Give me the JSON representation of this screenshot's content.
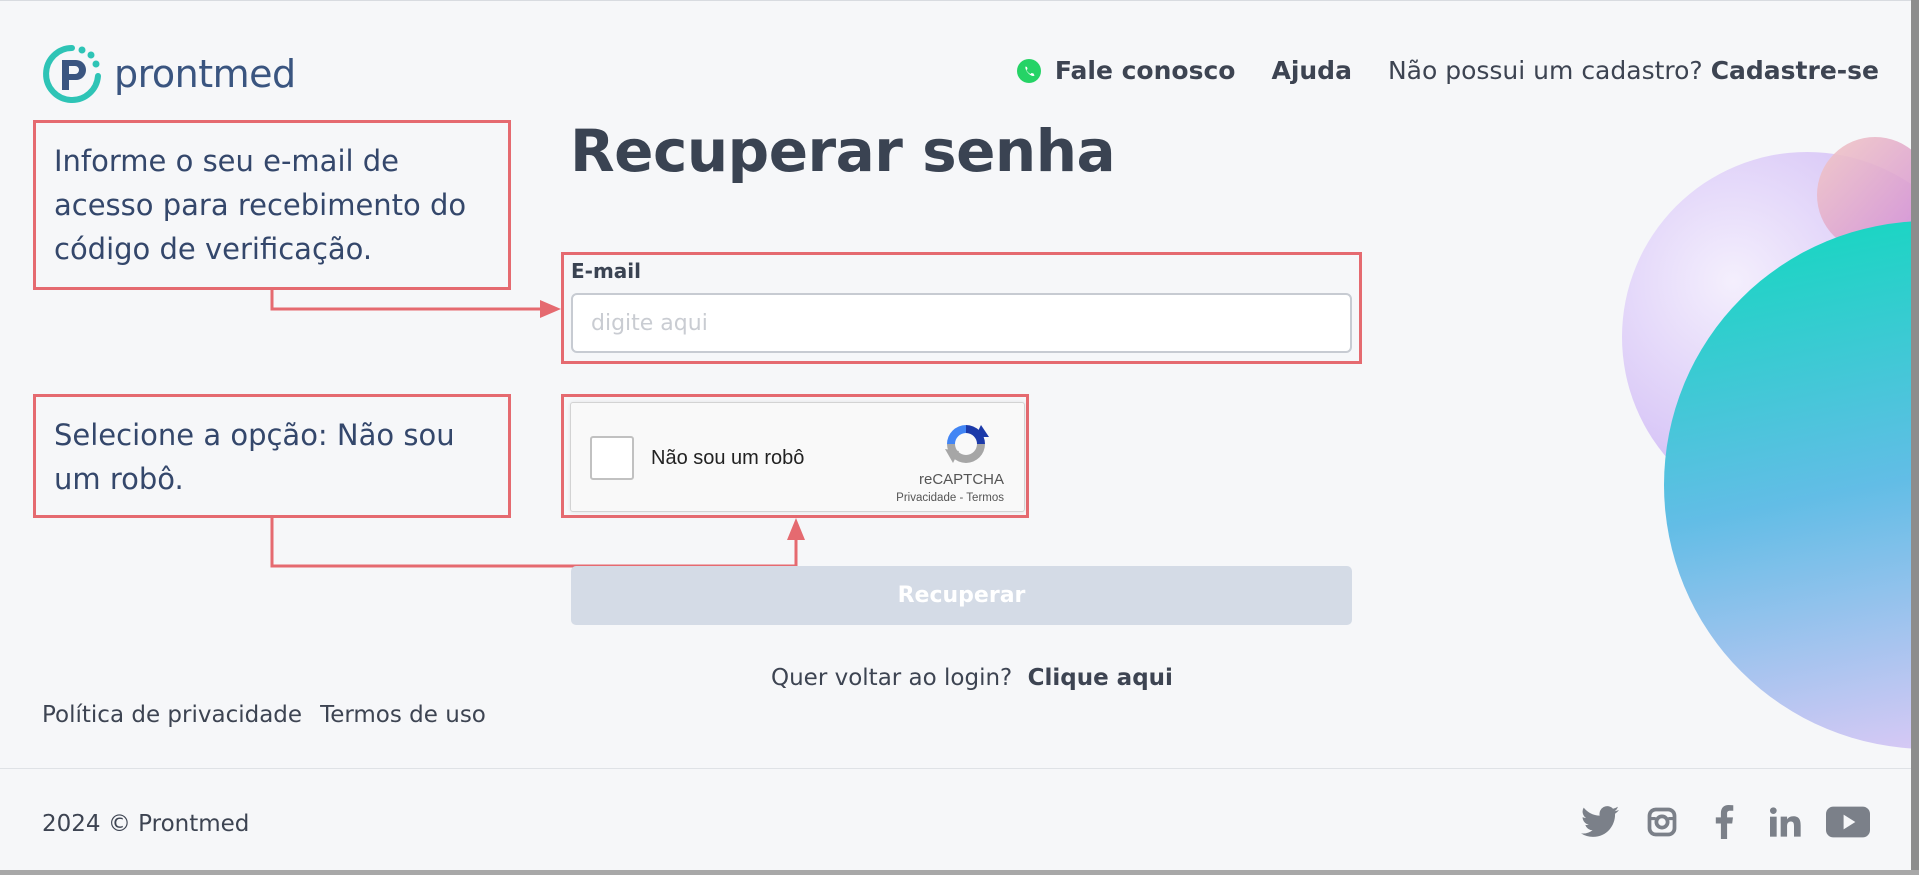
{
  "brand": {
    "name": "prontmed",
    "accent": "#2ec4b6",
    "dark": "#3a5580"
  },
  "nav": {
    "contact": "Fale conosco",
    "help": "Ajuda",
    "signup_question": "Não possui um cadastro?",
    "signup_link": "Cadastre-se"
  },
  "page": {
    "title": "Recuperar senha"
  },
  "callouts": {
    "email": "Informe o seu e-mail de acesso para recebimento do código de verificação.",
    "captcha": "Selecione a opção: Não sou um robô.",
    "border_color": "#e56a70"
  },
  "form": {
    "email_label": "E-mail",
    "email_placeholder": "digite aqui",
    "email_value": "",
    "captcha_label": "Não sou um robô",
    "captcha_brand": "reCAPTCHA",
    "captcha_privacy": "Privacidade",
    "captcha_separator": "-",
    "captcha_terms": "Termos",
    "submit_label": "Recuperar",
    "back_question": "Quer voltar ao login?",
    "back_link": "Clique aqui"
  },
  "footer": {
    "privacy": "Política de privacidade",
    "terms": "Termos de uso",
    "copyright": "2024 © Prontmed",
    "social_icons": [
      "twitter-icon",
      "instagram-icon",
      "facebook-icon",
      "linkedin-icon",
      "youtube-icon"
    ]
  }
}
